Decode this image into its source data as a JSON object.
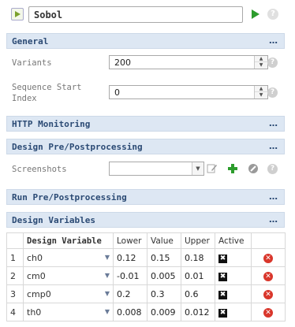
{
  "top": {
    "name_value": "Sobol",
    "run_icon": "play-icon",
    "help_icon": "question-icon"
  },
  "sections": {
    "general": "General",
    "http": "HTTP Monitoring",
    "design_pp": "Design Pre/Postprocessing",
    "run_pp": "Run Pre/Postprocessing",
    "design_vars": "Design Variables",
    "menu": "…"
  },
  "general": {
    "variants_label": "Variants",
    "variants_value": "200",
    "seq_label_1": "Sequence Start",
    "seq_label_2": "Index",
    "seq_value": "0"
  },
  "design_pp": {
    "screenshots_label": "Screenshots",
    "screenshots_value": ""
  },
  "design_vars": {
    "columns": [
      "Design Variable",
      "Lower",
      "Value",
      "Upper",
      "Active"
    ],
    "rows": [
      {
        "idx": "1",
        "name": "ch0",
        "lower": "0.12",
        "value": "0.15",
        "upper": "0.18"
      },
      {
        "idx": "2",
        "name": "cm0",
        "lower": "-0.01",
        "value": "0.005",
        "upper": "0.01"
      },
      {
        "idx": "3",
        "name": "cmp0",
        "lower": "0.2",
        "value": "0.3",
        "upper": "0.6"
      },
      {
        "idx": "4",
        "name": "th0",
        "lower": "0.008",
        "value": "0.009",
        "upper": "0.012"
      }
    ]
  },
  "colors": {
    "section_bg": "#dde7f3",
    "section_text": "#2b4a74",
    "accent_green": "#2c9c2c",
    "delete_red": "#d9362b"
  }
}
